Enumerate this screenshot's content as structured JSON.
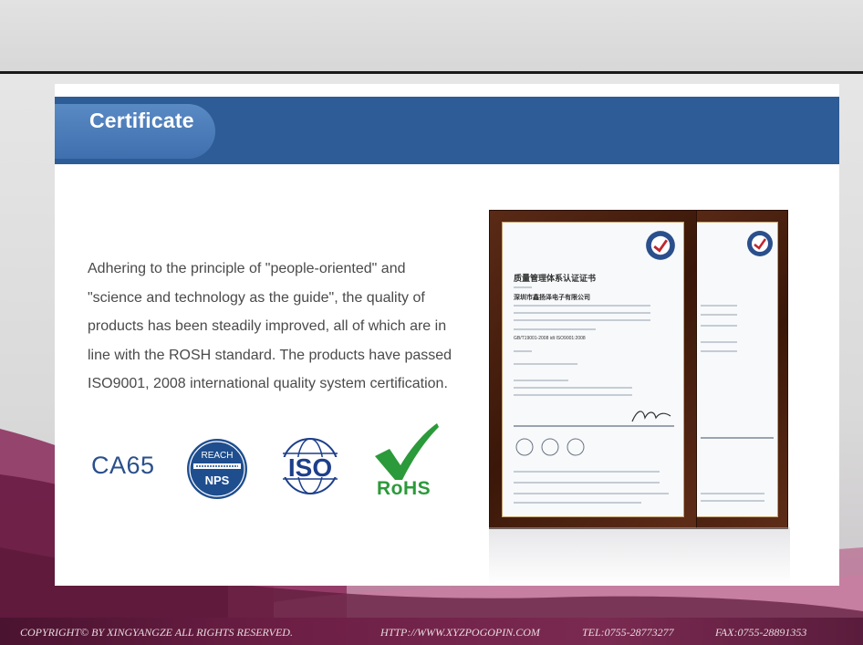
{
  "header": {
    "title": "Certificate"
  },
  "body": {
    "lines": [
      "Adhering to the principle of \"people-oriented\" and",
      "\"science and technology as the guide\", the quality of",
      "products has been steadily improved, all of which are in",
      "line with the ROSH standard. The products have passed",
      "ISO9001, 2008 international quality system certification."
    ]
  },
  "logos": {
    "ca65": "CA65",
    "reach": "REACH",
    "nps": "NPS",
    "iso": "ISO",
    "rohs": "RoHS"
  },
  "certificate": {
    "title": "质量管理体系认证证书",
    "company": "深圳市鑫扬泽电子有限公司",
    "standard": "GB/T19001-2008 idt ISO9001:2008"
  },
  "footer": {
    "copyright": "COPYRIGHT© BY XINGYANGZE ALL RIGHTS RESERVED.",
    "website": "HTTP://WWW.XYZPOGOPIN.COM",
    "tel": "TEL:0755-28773277",
    "fax": "FAX:0755-28891353"
  },
  "colors": {
    "header_bar": "#2e5c96",
    "header_tab": "#4a7bbb",
    "footer": "#6e1f45",
    "rohs_green": "#2b9a3a",
    "iso_blue": "#1d3f8a"
  }
}
